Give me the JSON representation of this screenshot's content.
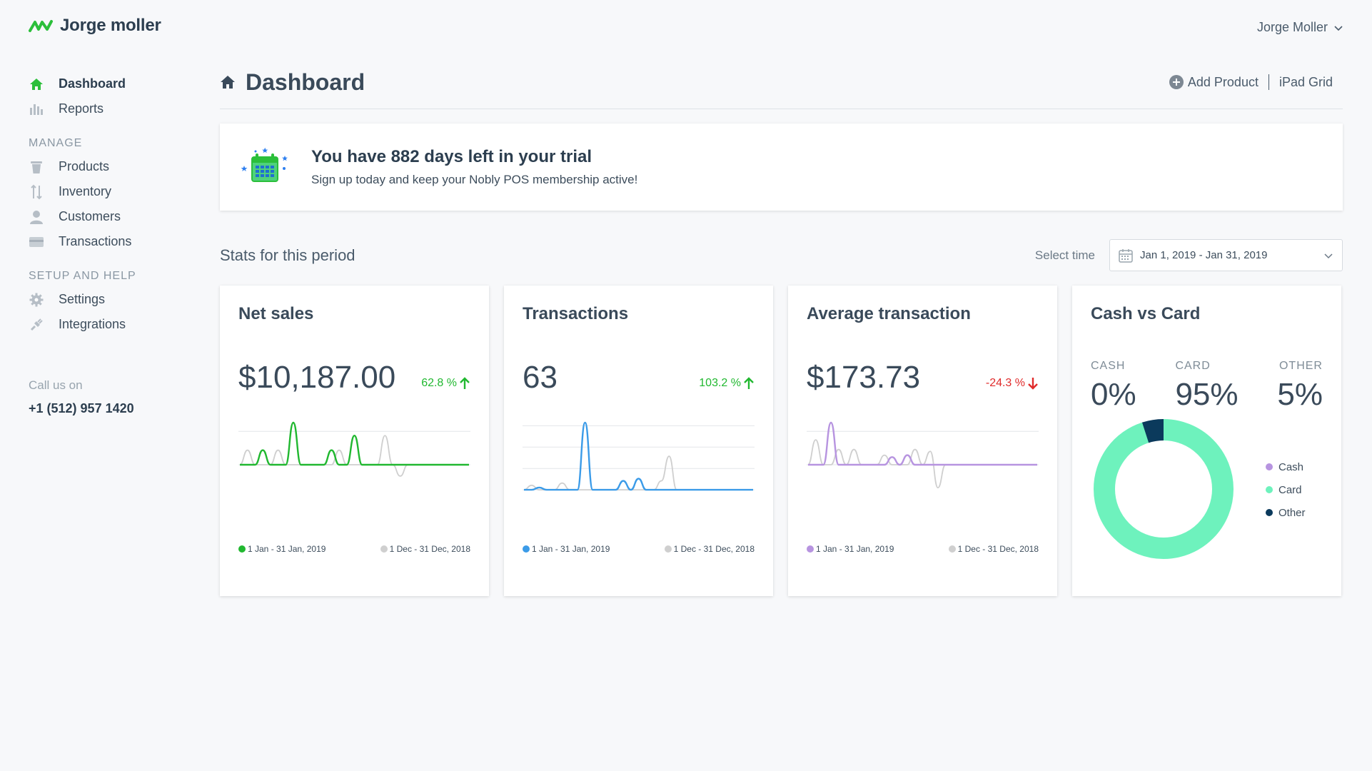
{
  "brand": {
    "name": "Jorge moller",
    "color": "#2bbf3a"
  },
  "user": {
    "name": "Jorge Moller"
  },
  "sidebar": {
    "top_items": [
      {
        "label": "Dashboard",
        "icon": "home-icon",
        "active": true
      },
      {
        "label": "Reports",
        "icon": "bar-chart-icon"
      }
    ],
    "manage_label": "MANAGE",
    "manage_items": [
      {
        "label": "Products",
        "icon": "trash-bin-icon"
      },
      {
        "label": "Inventory",
        "icon": "up-down-arrows-icon"
      },
      {
        "label": "Customers",
        "icon": "person-icon"
      },
      {
        "label": "Transactions",
        "icon": "card-icon"
      }
    ],
    "setup_label": "SETUP AND HELP",
    "setup_items": [
      {
        "label": "Settings",
        "icon": "gear-icon"
      },
      {
        "label": "Integrations",
        "icon": "plug-icon"
      }
    ],
    "call_label": "Call us on",
    "call_phone": "+1 (512) 957 1420"
  },
  "header": {
    "title": "Dashboard",
    "add_product": "Add Product",
    "ipad_grid": "iPad Grid"
  },
  "trial": {
    "title": "You have 882 days left in your trial",
    "subtitle": "Sign up today and keep your Nobly POS membership active!"
  },
  "stats": {
    "title": "Stats for this period",
    "select_label": "Select time",
    "date_range": "Jan 1, 2019 - Jan 31, 2019"
  },
  "cards": {
    "net_sales": {
      "title": "Net sales",
      "value": "$10,187.00",
      "delta": "62.8 %",
      "direction": "up",
      "color": "#21b830"
    },
    "transactions": {
      "title": "Transactions",
      "value": "63",
      "delta": "103.2 %",
      "direction": "up",
      "color": "#3b9be8"
    },
    "average": {
      "title": "Average transaction",
      "value": "$173.73",
      "delta": "-24.3 %",
      "direction": "down",
      "color": "#b794e0"
    },
    "legend_current": "1 Jan - 31 Jan, 2019",
    "legend_previous": "1 Dec - 31 Dec, 2018",
    "previous_color": "#cfcfcf"
  },
  "cash_card": {
    "title": "Cash vs Card",
    "cash_label": "CASH",
    "cash_value": "0%",
    "card_label": "CARD",
    "card_value": "95%",
    "other_label": "OTHER",
    "other_value": "5%",
    "legend": [
      {
        "label": "Cash",
        "color": "#b794e0"
      },
      {
        "label": "Card",
        "color": "#6ef2bd"
      },
      {
        "label": "Other",
        "color": "#0b3a5c"
      }
    ]
  },
  "chart_data": [
    {
      "type": "line",
      "title": "Net sales",
      "x": [
        1,
        2,
        3,
        4,
        5,
        6,
        7,
        8,
        9,
        10,
        11,
        12,
        13,
        14,
        15,
        16,
        17,
        18,
        19,
        20,
        21,
        22,
        23,
        24,
        25,
        26,
        27,
        28,
        29,
        30,
        31
      ],
      "series": [
        {
          "name": "1 Jan - 31 Jan, 2019",
          "values": [
            0,
            0,
            0,
            0.9,
            0,
            0,
            0,
            2.6,
            0,
            0,
            0,
            0,
            0.9,
            0,
            0,
            1.8,
            0,
            0,
            0,
            0,
            0,
            0,
            0,
            0,
            0,
            0,
            0,
            0,
            0,
            0,
            0
          ]
        },
        {
          "name": "1 Dec - 31 Dec, 2018",
          "values": [
            0,
            0.9,
            0,
            0,
            0,
            0.9,
            0,
            0,
            0,
            0,
            0,
            0,
            0,
            0.9,
            0,
            0,
            0,
            0,
            0,
            1.8,
            0,
            -0.7,
            0,
            0,
            0,
            0,
            0,
            0,
            0,
            0,
            0
          ]
        }
      ]
    },
    {
      "type": "line",
      "title": "Transactions",
      "x": [
        1,
        2,
        3,
        4,
        5,
        6,
        7,
        8,
        9,
        10,
        11,
        12,
        13,
        14,
        15,
        16,
        17,
        18,
        19,
        20,
        21,
        22,
        23,
        24,
        25,
        26,
        27,
        28,
        29,
        30,
        31
      ],
      "series": [
        {
          "name": "1 Jan - 31 Jan, 2019",
          "values": [
            0,
            0,
            0.1,
            0,
            0,
            0,
            0,
            0,
            3,
            0,
            0,
            0,
            0,
            0.4,
            0,
            0.5,
            0,
            0,
            0,
            0,
            0,
            0,
            0,
            0,
            0,
            0,
            0,
            0,
            0,
            0,
            0
          ]
        },
        {
          "name": "1 Dec - 31 Dec, 2018",
          "values": [
            0,
            0.2,
            0,
            0,
            0,
            0.3,
            0,
            0,
            0,
            0,
            0,
            0,
            0,
            0,
            0,
            0,
            0,
            0,
            0.4,
            1.5,
            0,
            0,
            0,
            0,
            0,
            0,
            0,
            0,
            0,
            0,
            0
          ]
        }
      ]
    },
    {
      "type": "line",
      "title": "Average transaction",
      "x": [
        1,
        2,
        3,
        4,
        5,
        6,
        7,
        8,
        9,
        10,
        11,
        12,
        13,
        14,
        15,
        16,
        17,
        18,
        19,
        20,
        21,
        22,
        23,
        24,
        25,
        26,
        27,
        28,
        29,
        30,
        31
      ],
      "series": [
        {
          "name": "1 Jan - 31 Jan, 2019",
          "values": [
            0,
            0,
            0,
            2.2,
            0,
            0,
            0,
            0,
            0,
            0,
            0,
            0.4,
            0,
            0.5,
            0,
            0,
            0,
            0,
            0,
            0,
            0,
            0,
            0,
            0,
            0,
            0,
            0,
            0,
            0,
            0,
            0
          ]
        },
        {
          "name": "1 Dec - 31 Dec, 2018",
          "values": [
            0,
            1.3,
            0,
            0,
            0.8,
            0,
            0.8,
            0,
            0,
            0,
            0.5,
            0,
            0,
            0,
            0.8,
            0,
            0.7,
            -1.2,
            0,
            0,
            0,
            0,
            0,
            0,
            0,
            0,
            0,
            0,
            0,
            0,
            0
          ]
        }
      ]
    },
    {
      "type": "pie",
      "title": "Cash vs Card",
      "categories": [
        "Cash",
        "Card",
        "Other"
      ],
      "values": [
        0,
        95,
        5
      ]
    }
  ]
}
